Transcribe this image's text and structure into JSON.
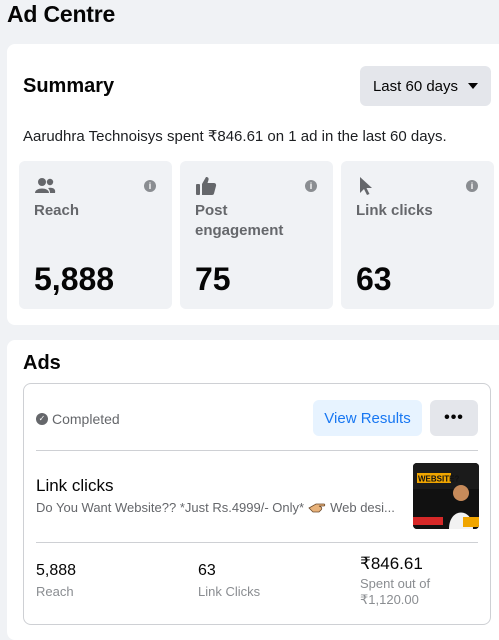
{
  "page": {
    "title": "Ad Centre"
  },
  "summary": {
    "title": "Summary",
    "range_label": "Last 60 days",
    "text": "Aarudhra Technoisys spent ₹846.61 on 1 ad in the last 60 days.",
    "metrics": [
      {
        "label": "Reach",
        "value": "5,888",
        "icon": "people-icon"
      },
      {
        "label": "Post engagement",
        "value": "75",
        "icon": "thumbs-up-icon"
      },
      {
        "label": "Link clicks",
        "value": "63",
        "icon": "cursor-icon"
      }
    ]
  },
  "ads": {
    "title": "Ads",
    "ad": {
      "status": "Completed",
      "view_results": "View Results",
      "more": "•••",
      "objective": "Link clicks",
      "description_a": "Do You Want Website?? *Just Rs.4999/- Only*",
      "description_b": "Web desi...",
      "thumbnail_text": "WEBSITE?",
      "stats": [
        {
          "value": "5,888",
          "label": "Reach"
        },
        {
          "value": "63",
          "label": "Link Clicks"
        },
        {
          "value": "₹846.61",
          "label": "Spent out of",
          "label2": "₹1,120.00"
        }
      ]
    }
  },
  "colors": {
    "accent": "#1877f2",
    "accent_bg": "#e7f3ff",
    "muted": "#65676b"
  }
}
